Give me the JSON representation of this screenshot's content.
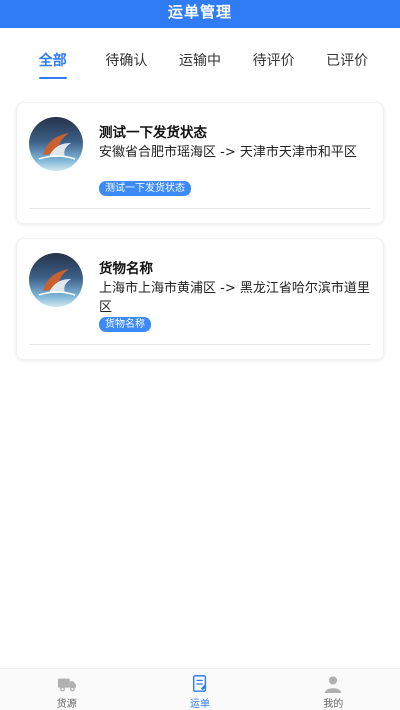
{
  "header": {
    "title": "运单管理"
  },
  "tabs": [
    {
      "label": "全部",
      "active": true
    },
    {
      "label": "待确认",
      "active": false
    },
    {
      "label": "运输中",
      "active": false
    },
    {
      "label": "待评价",
      "active": false
    },
    {
      "label": "已评价",
      "active": false
    }
  ],
  "orders": [
    {
      "title": "测试一下发货状态",
      "route": "安徽省合肥市瑶海区 -> 天津市天津市和平区",
      "tag": "测试一下发货状态"
    },
    {
      "title": "货物名称",
      "route": "上海市上海市黄浦区 -> 黑龙江省哈尔滨市道里区",
      "tag": "货物名称"
    }
  ],
  "tabbar": [
    {
      "label": "货源",
      "icon": "truck-icon",
      "active": false
    },
    {
      "label": "运单",
      "icon": "waybill-icon",
      "active": true
    },
    {
      "label": "我的",
      "icon": "user-icon",
      "active": false
    }
  ],
  "colors": {
    "primary": "#2f7cf6",
    "tag": "#3b8af7"
  }
}
